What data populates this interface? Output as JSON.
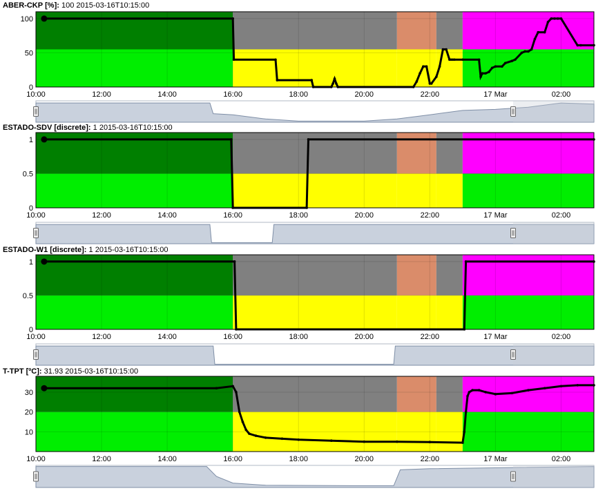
{
  "time_ticks": [
    "10:00",
    "12:00",
    "14:00",
    "16:00",
    "18:00",
    "20:00",
    "22:00",
    "17 Mar",
    "02:00"
  ],
  "chart_data": [
    {
      "type": "line",
      "series_name": "ABER-CKP",
      "unit": "[%]",
      "readout_value": "100",
      "readout_time": "2015-03-16T10:15:00",
      "ylim": [
        0,
        110
      ],
      "yticks": [
        "0",
        "50",
        "100"
      ],
      "ytick_values": [
        0,
        50,
        100
      ],
      "band_threshold": 55,
      "x_hours": [
        10.25,
        16.0,
        16.03,
        17.3,
        17.35,
        18.4,
        18.45,
        19.0,
        19.05,
        19.1,
        19.15,
        19.2,
        21.5,
        21.6,
        21.7,
        21.8,
        21.9,
        22.0,
        22.05,
        22.2,
        22.3,
        22.4,
        22.5,
        22.6,
        22.65,
        22.7,
        22.75,
        23.0,
        23.5,
        23.55,
        23.6,
        23.7,
        23.8,
        23.9,
        24.0,
        24.2,
        24.3,
        24.5,
        24.6,
        24.8,
        24.9,
        25.0,
        25.1,
        25.2,
        25.3,
        25.5,
        25.6,
        25.7,
        25.8,
        25.9,
        26.0,
        26.5,
        26.6,
        27.0
      ],
      "y_values": [
        100,
        100,
        40,
        40,
        10,
        10,
        0,
        0,
        5,
        12,
        5,
        0,
        0,
        8,
        20,
        30,
        30,
        5,
        5,
        15,
        30,
        55,
        55,
        40,
        40,
        40,
        40,
        40,
        40,
        15,
        20,
        20,
        22,
        28,
        30,
        30,
        35,
        38,
        40,
        50,
        52,
        52,
        55,
        70,
        80,
        80,
        95,
        100,
        100,
        100,
        100,
        61,
        61,
        61
      ],
      "series_color": "#000000"
    },
    {
      "type": "line",
      "series_name": "ESTADO-SDV",
      "unit": "[discrete]",
      "readout_value": "1",
      "readout_time": "2015-03-16T10:15:00",
      "ylim": [
        0,
        1.1
      ],
      "yticks": [
        "0",
        "0.5",
        "1"
      ],
      "ytick_values": [
        0,
        0.5,
        1
      ],
      "band_threshold": 0.5,
      "x_hours": [
        10.25,
        15.95,
        16.0,
        18.25,
        18.3,
        27.0
      ],
      "y_values": [
        1,
        1,
        0,
        0,
        1,
        1
      ],
      "series_color": "#000000"
    },
    {
      "type": "line",
      "series_name": "ESTADO-W1",
      "unit": "[discrete]",
      "readout_value": "1",
      "readout_time": "2015-03-16T10:15:00",
      "ylim": [
        0,
        1.1
      ],
      "yticks": [
        "0",
        "0.5",
        "1"
      ],
      "ytick_values": [
        0,
        0.5,
        1
      ],
      "band_threshold": 0.5,
      "x_hours": [
        10.25,
        16.05,
        16.1,
        23.05,
        23.1,
        27.0
      ],
      "y_values": [
        1,
        1,
        0,
        0,
        1,
        1
      ],
      "series_color": "#000000"
    },
    {
      "type": "line",
      "series_name": "T-TPT",
      "unit": "[ºC]",
      "readout_value": "31.93",
      "readout_time": "2015-03-16T10:15:00",
      "ylim": [
        0,
        38
      ],
      "yticks": [
        "10",
        "20",
        "30"
      ],
      "ytick_values": [
        10,
        20,
        30
      ],
      "band_threshold": 20,
      "x_hours": [
        10.25,
        15.5,
        16.0,
        16.1,
        16.2,
        16.3,
        16.4,
        16.5,
        16.7,
        17.0,
        17.5,
        18.0,
        19.0,
        20.0,
        21.0,
        22.0,
        23.0,
        23.05,
        23.1,
        23.15,
        23.2,
        23.3,
        23.5,
        23.7,
        24.0,
        24.5,
        25.0,
        25.5,
        26.0,
        26.5,
        27.0
      ],
      "y_values": [
        32,
        32,
        33,
        30,
        20,
        15,
        11,
        9,
        8,
        7,
        6.5,
        6,
        5.5,
        5,
        5,
        4.8,
        4.5,
        10,
        20,
        28,
        30,
        31,
        31,
        30,
        29,
        29.5,
        31,
        32,
        33,
        33.5,
        33.5
      ],
      "series_color": "#000000"
    }
  ],
  "zones": [
    {
      "from": 10.0,
      "to": 16.0,
      "upper": "#007f00",
      "lower": "#00ee00"
    },
    {
      "from": 16.0,
      "to": 21.0,
      "upper": "#808080",
      "lower": "#ffff00"
    },
    {
      "from": 21.0,
      "to": 22.2,
      "upper": "#da8c6a",
      "lower": "#ffff00"
    },
    {
      "from": 22.2,
      "to": 23.0,
      "upper": "#808080",
      "lower": "#ffff00"
    },
    {
      "from": 23.0,
      "to": 27.0,
      "upper": "#ff00ff",
      "lower": "#00ee00"
    }
  ],
  "x_range_hours": [
    10.0,
    27.0
  ],
  "navigators": [
    {
      "name": "ABER-CKP",
      "profile": [
        [
          10,
          0.9
        ],
        [
          15.3,
          0.9
        ],
        [
          15.4,
          0.4
        ],
        [
          16,
          0.35
        ],
        [
          17,
          0.15
        ],
        [
          18,
          0.05
        ],
        [
          19,
          0.05
        ],
        [
          20,
          0.05
        ],
        [
          21,
          0.15
        ],
        [
          22,
          0.35
        ],
        [
          23,
          0.55
        ],
        [
          24,
          0.6
        ],
        [
          25,
          0.7
        ],
        [
          26,
          0.9
        ],
        [
          27,
          0.85
        ]
      ]
    },
    {
      "name": "ESTADO-SDV",
      "profile": [
        [
          10,
          0.9
        ],
        [
          15.3,
          0.9
        ],
        [
          15.35,
          0.05
        ],
        [
          17.2,
          0.05
        ],
        [
          17.25,
          0.9
        ],
        [
          27,
          0.9
        ]
      ]
    },
    {
      "name": "ESTADO-W1",
      "profile": [
        [
          10,
          0.9
        ],
        [
          15.4,
          0.9
        ],
        [
          15.45,
          0.05
        ],
        [
          20.9,
          0.05
        ],
        [
          20.95,
          0.9
        ],
        [
          27,
          0.9
        ]
      ]
    },
    {
      "name": "T-TPT",
      "profile": [
        [
          10,
          0.95
        ],
        [
          15.2,
          0.95
        ],
        [
          15.5,
          0.5
        ],
        [
          16.0,
          0.2
        ],
        [
          17,
          0.1
        ],
        [
          20,
          0.08
        ],
        [
          20.9,
          0.08
        ],
        [
          21.1,
          0.8
        ],
        [
          22,
          0.85
        ],
        [
          27,
          0.95
        ]
      ]
    }
  ]
}
